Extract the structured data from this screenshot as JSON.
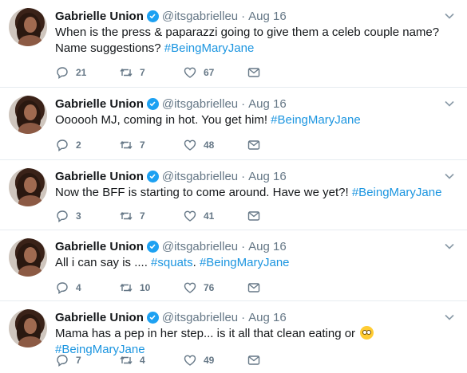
{
  "tweets": [
    {
      "name": "Gabrielle Union",
      "handle": "@itsgabrielleu",
      "separator": "·",
      "date": "Aug 16",
      "text": "When is the press & paparazzi going to give them a celeb couple name? Name suggestions? ",
      "hashtag": "#BeingMaryJane",
      "emoji": false,
      "replies": "21",
      "retweets": "7",
      "likes": "67"
    },
    {
      "name": "Gabrielle Union",
      "handle": "@itsgabrielleu",
      "separator": "·",
      "date": "Aug 16",
      "text": "Oooooh MJ, coming in hot. You get him! ",
      "hashtag": "#BeingMaryJane",
      "emoji": false,
      "replies": "2",
      "retweets": "7",
      "likes": "48"
    },
    {
      "name": "Gabrielle Union",
      "handle": "@itsgabrielleu",
      "separator": "·",
      "date": "Aug 16",
      "text": "Now the BFF is starting to come around. Have we yet?! ",
      "hashtag": "#BeingMaryJane",
      "emoji": false,
      "replies": "3",
      "retweets": "7",
      "likes": "41"
    },
    {
      "name": "Gabrielle Union",
      "handle": "@itsgabrielleu",
      "separator": "·",
      "date": "Aug 16",
      "text": "All i can say is .... ",
      "hashtag_inline": "#squats",
      "text_mid": ". ",
      "hashtag": "#BeingMaryJane",
      "emoji": false,
      "replies": "4",
      "retweets": "10",
      "likes": "76"
    },
    {
      "name": "Gabrielle Union",
      "handle": "@itsgabrielleu",
      "separator": "·",
      "date": "Aug 16",
      "text": "Mama has a pep in her step... is it all that clean eating or ",
      "hashtag": "#BeingMaryJane",
      "emoji": true,
      "emoji_name": "eye-roll-emoji",
      "replies": "7",
      "retweets": "4",
      "likes": "49"
    }
  ],
  "colors": {
    "accent": "#1b95e0",
    "verified": "#1da1f2",
    "muted": "#657786",
    "divider": "#e6ecf0"
  },
  "icons": [
    "verified-badge-icon",
    "caret-down-icon",
    "reply-icon",
    "retweet-icon",
    "like-icon",
    "direct-message-icon"
  ]
}
